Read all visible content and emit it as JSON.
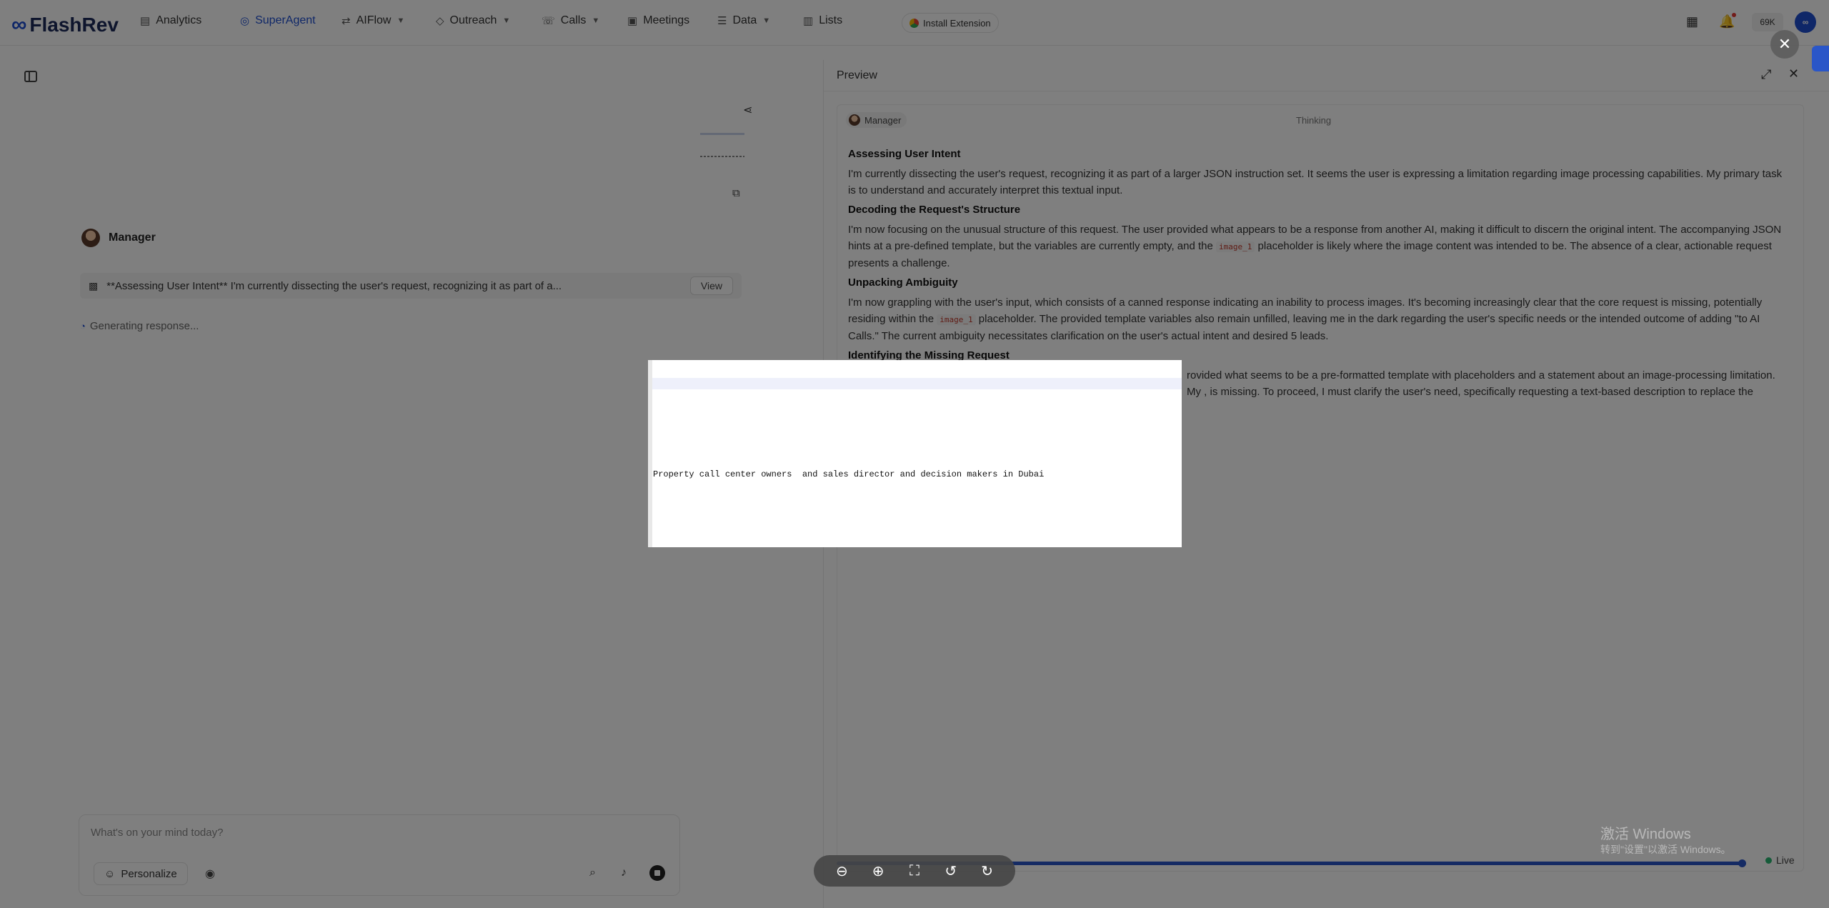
{
  "app": {
    "name": "FlashRev"
  },
  "nav": {
    "items": [
      {
        "label": "Analytics"
      },
      {
        "label": "SuperAgent"
      },
      {
        "label": "AIFlow"
      },
      {
        "label": "Outreach"
      },
      {
        "label": "Calls"
      },
      {
        "label": "Meetings"
      },
      {
        "label": "Data"
      },
      {
        "label": "Lists"
      }
    ],
    "install_extension": "Install Extension",
    "credits": "69K"
  },
  "chat": {
    "agent_name": "Manager",
    "thinking_summary": "**Assessing User Intent** I'm currently dissecting the user's request, recognizing it as part of a...",
    "view_label": "View",
    "generating": "Generating response...",
    "composer_placeholder": "What's on your mind today?",
    "personalize_label": "Personalize"
  },
  "preview": {
    "title": "Preview",
    "agent_chip": "Manager",
    "status": "Thinking",
    "progress_fraction": 0.99,
    "live_label": "Live",
    "sections": [
      {
        "heading": "Assessing User Intent",
        "text": "I'm currently dissecting the user's request, recognizing it as part of a larger JSON instruction set. It seems the user is expressing a limitation regarding image processing capabilities. My primary task is to understand and accurately interpret this textual input."
      },
      {
        "heading": "Decoding the Request's Structure",
        "pre": "I'm now focusing on the unusual structure of this request. The user provided what appears to be a response from another AI, making it difficult to discern the original intent. The accompanying JSON hints at a pre-defined template, but the variables are currently empty, and the",
        "code": "image_1",
        "post": "placeholder is likely where the image content was intended to be. The absence of a clear, actionable request presents a challenge."
      },
      {
        "heading": "Unpacking Ambiguity",
        "pre": "I'm now grappling with the user's input, which consists of a canned response indicating an inability to process images. It's becoming increasingly clear that the core request is missing, potentially residing within the",
        "code": "image_1",
        "post": "placeholder. The provided template variables also remain unfilled, leaving me in the dark regarding the user's specific needs or the intended outcome of adding \"to AI Calls.\" The current ambiguity necessitates clarification on the user's actual intent and desired 5 leads."
      },
      {
        "heading": "Identifying the Missing Request",
        "text": "rovided what seems to be a pre-formatted template with placeholders and a statement about an image-processing limitation. My , is missing. To proceed, I must clarify the user's need, specifically requesting a text-based description to replace the"
      }
    ]
  },
  "viewer": {
    "image_text": "Property call center owners  and sales director and decision makers in Dubai"
  },
  "watermark": {
    "line1": "激活 Windows",
    "line2": "转到\"设置\"以激活 Windows。"
  },
  "colors": {
    "accent": "#1f4fd1",
    "live": "#2bb673",
    "code": "#c0392b"
  },
  "icons": {
    "analytics": "analytics-icon",
    "superagent": "superagent-icon",
    "aiflow": "aiflow-icon",
    "outreach": "outreach-icon",
    "calls": "phone-icon",
    "meetings": "video-icon",
    "data": "database-icon",
    "lists": "list-icon"
  }
}
